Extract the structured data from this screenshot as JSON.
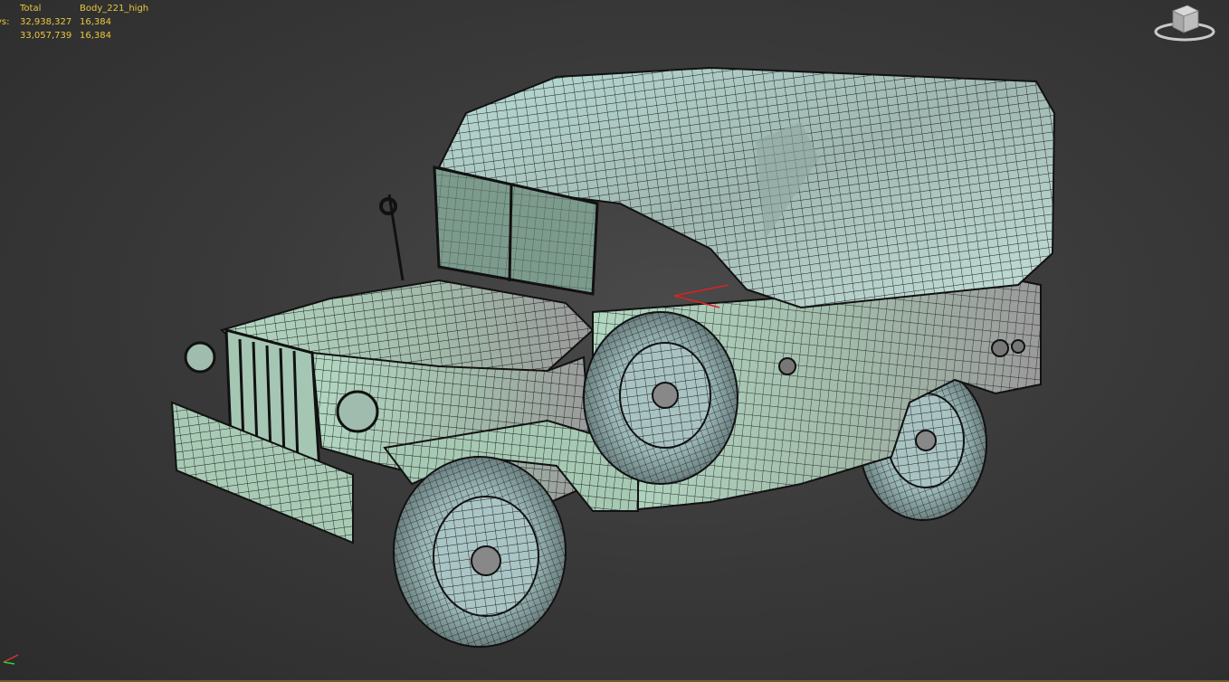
{
  "viewport": {
    "stats": {
      "headers": [
        "Total",
        "Body_221_high"
      ],
      "rows": [
        {
          "label": "ys:",
          "total": "32,938,327",
          "selected": "16,384"
        },
        {
          "label": ":",
          "total": "33,057,739",
          "selected": "16,384"
        }
      ]
    },
    "viewcube_icon": "viewcube-icon",
    "axis_icon": "world-axis-icon",
    "model_icon": "wireframe-military-truck"
  },
  "colors": {
    "background": "#3a3a3a",
    "stats_text": "#e8c840",
    "body_shade": "#a7c9b4",
    "wire": "#1a1a1a"
  }
}
